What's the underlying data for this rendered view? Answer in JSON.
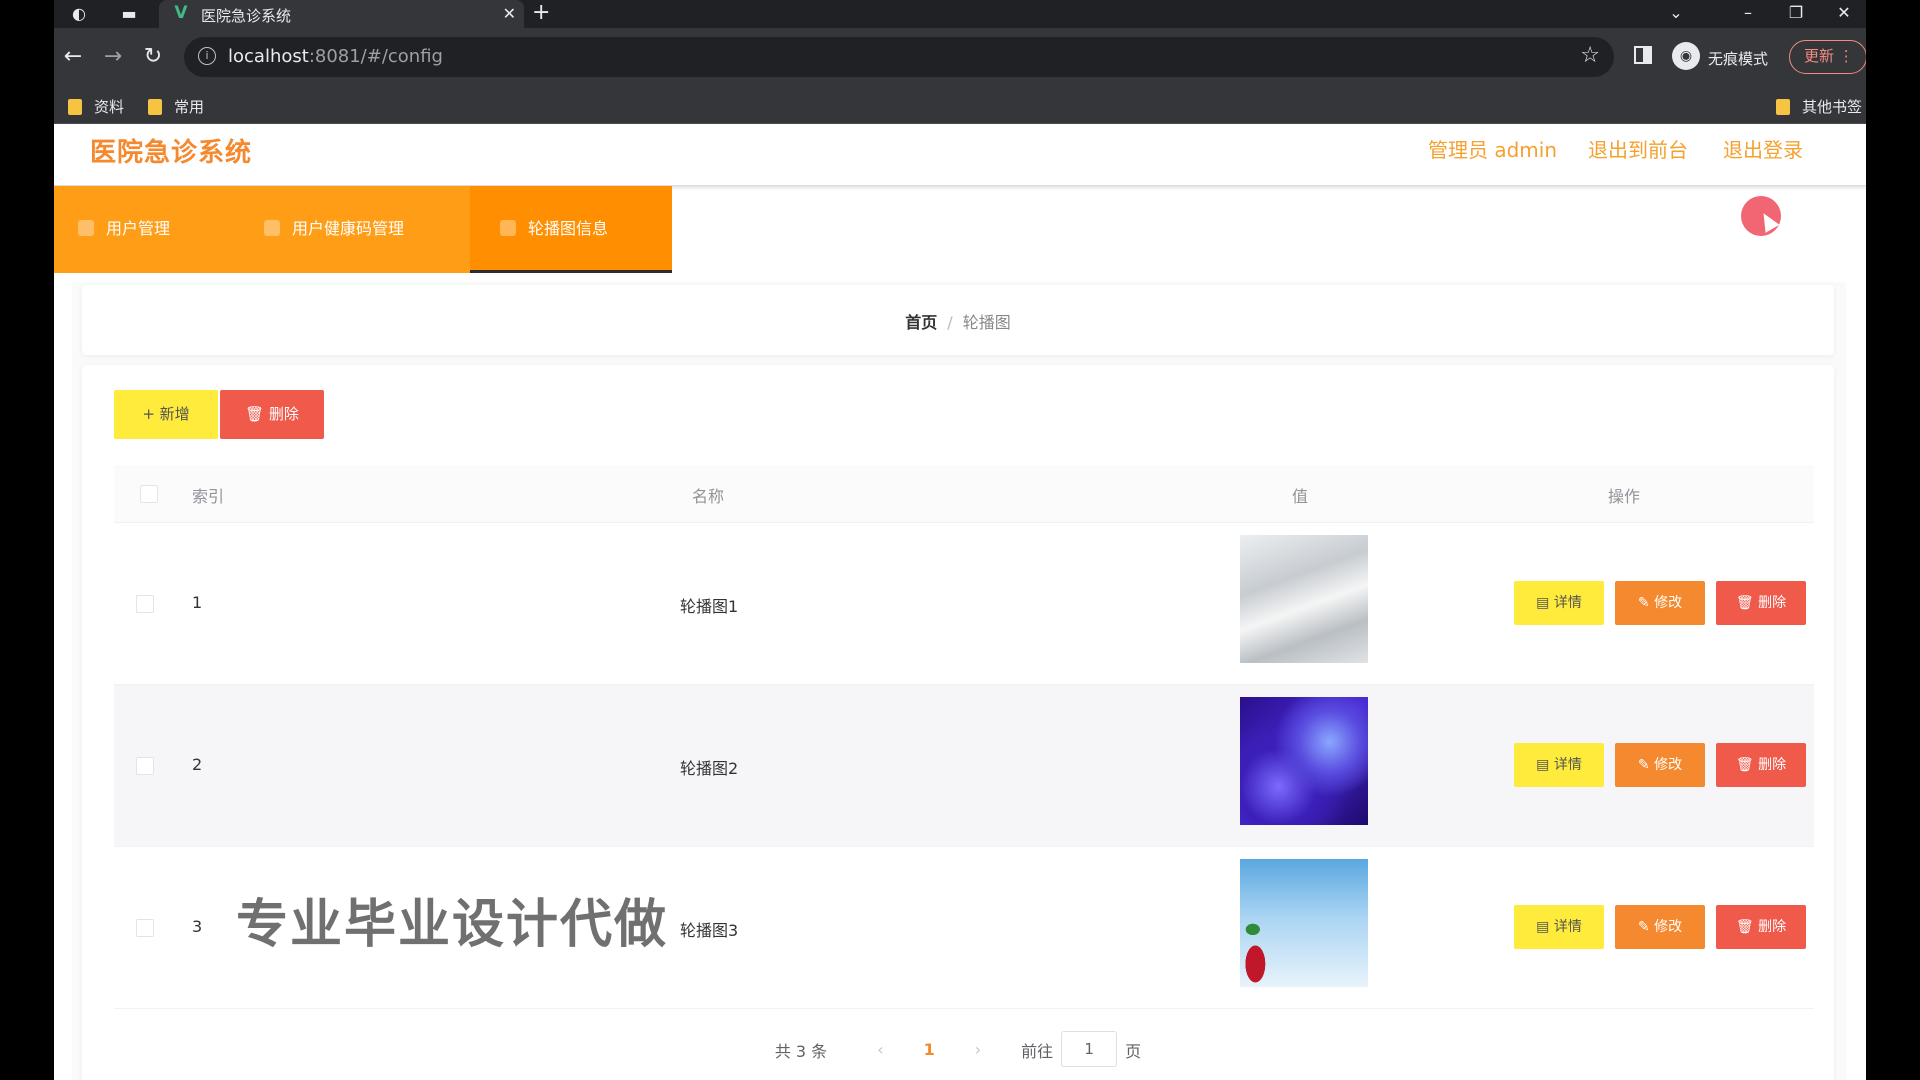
{
  "browser": {
    "tab_title": "医院急诊系统",
    "url_host": "localhost",
    "url_rest": ":8081/#/config",
    "incognito_label": "无痕模式",
    "update_label": "更新",
    "bookmarks": [
      "资料",
      "常用"
    ],
    "other_bookmarks": "其他书签"
  },
  "header": {
    "title": "医院急诊系统",
    "user_label": "管理员 admin",
    "to_front_label": "退出到前台",
    "logout_label": "退出登录"
  },
  "menu": {
    "items": [
      {
        "label": "用户管理"
      },
      {
        "label": "用户健康码管理"
      },
      {
        "label": "轮播图信息"
      }
    ]
  },
  "breadcrumb": {
    "home": "首页",
    "separator": "/",
    "current": "轮播图"
  },
  "toolbar": {
    "add_label": "新增",
    "delete_label": "删除"
  },
  "table": {
    "columns": [
      "索引",
      "名称",
      "值",
      "操作"
    ],
    "rows": [
      {
        "index": "1",
        "name": "轮播图1",
        "image": "light-gray-texture"
      },
      {
        "index": "2",
        "name": "轮播图2",
        "image": "purple-blue-bokeh"
      },
      {
        "index": "3",
        "name": "轮播图3",
        "image": "sky-with-red-fruit"
      }
    ],
    "actions": {
      "detail": "详情",
      "edit": "修改",
      "delete": "删除"
    }
  },
  "pager": {
    "total_text": "共 3 条",
    "current_page": "1",
    "goto_label": "前往",
    "goto_value": "1",
    "page_suffix": "页"
  },
  "watermark": "专业毕业设计代做",
  "colors": {
    "brand": "#f5892f",
    "menu": "#ff9d17",
    "add": "#ffeb3b",
    "danger": "#ef5a4b"
  }
}
